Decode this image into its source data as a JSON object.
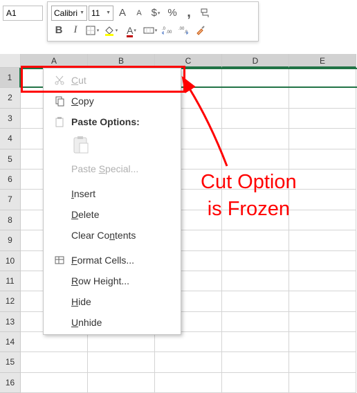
{
  "nameBox": "A1",
  "toolbar": {
    "fontName": "Calibri",
    "fontSize": "11",
    "increaseFont": "A",
    "decreaseFont": "A",
    "currency": "$",
    "percent": "%",
    "comma": ",",
    "bold": "B",
    "italic": "I",
    "underlineA": "A"
  },
  "columns": [
    "A",
    "B",
    "C",
    "D",
    "E"
  ],
  "rows": [
    "1",
    "2",
    "3",
    "4",
    "5",
    "6",
    "7",
    "8",
    "9",
    "10",
    "11",
    "12",
    "13",
    "14",
    "15",
    "16"
  ],
  "menu": {
    "cut": "Cut",
    "copy": "Copy",
    "pasteOptions": "Paste Options:",
    "pasteSpecial": "Paste Special...",
    "insert": "Insert",
    "delete": "Delete",
    "clearContents": "Clear Contents",
    "formatCells": "Format Cells...",
    "rowHeight": "Row Height...",
    "hide": "Hide",
    "unhide": "Unhide"
  },
  "annotation": {
    "line1": "Cut Option",
    "line2": "is Frozen"
  }
}
